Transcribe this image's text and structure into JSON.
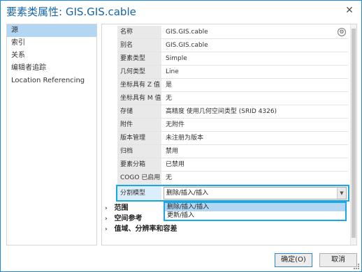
{
  "window": {
    "title": "要素类属性: GIS.GIS.cable",
    "close_label": "✕"
  },
  "sidebar": {
    "items": [
      {
        "label": "源",
        "selected": true
      },
      {
        "label": "索引",
        "selected": false
      },
      {
        "label": "关系",
        "selected": false
      },
      {
        "label": "编辑者追踪",
        "selected": false
      },
      {
        "label": "Location Referencing",
        "selected": false
      }
    ]
  },
  "properties": [
    {
      "label": "名称",
      "value": "GIS.GIS.cable"
    },
    {
      "label": "别名",
      "value": "GIS.GIS.cable"
    },
    {
      "label": "要素类型",
      "value": "Simple"
    },
    {
      "label": "几何类型",
      "value": "Line"
    },
    {
      "label": "坐标具有 Z 值",
      "value": "是"
    },
    {
      "label": "坐标具有 M 值",
      "value": "无"
    },
    {
      "label": "存储",
      "value": "高精度 使用几何空间类型 (SRID 4326)"
    },
    {
      "label": "附件",
      "value": "无附件"
    },
    {
      "label": "版本管理",
      "value": "未注册为版本"
    },
    {
      "label": "归档",
      "value": "禁用"
    },
    {
      "label": "要素分箱",
      "value": "已禁用"
    },
    {
      "label": "COGO 已启用",
      "value": "无"
    }
  ],
  "split_model": {
    "label": "分割模型",
    "selected_value": "删除/插入/插入",
    "options": [
      "删除/插入/插入",
      "更新/插入"
    ],
    "highlighted_option": 0
  },
  "sections": [
    {
      "label": "范围"
    },
    {
      "label": "空间参考"
    },
    {
      "label": "值域、分辨率和容差"
    }
  ],
  "buttons": {
    "ok": "确定(O)",
    "cancel": "取消"
  },
  "colors": {
    "accent": "#19a8e6",
    "title": "#1565a8",
    "selected_bg": "#b3d7f3"
  }
}
